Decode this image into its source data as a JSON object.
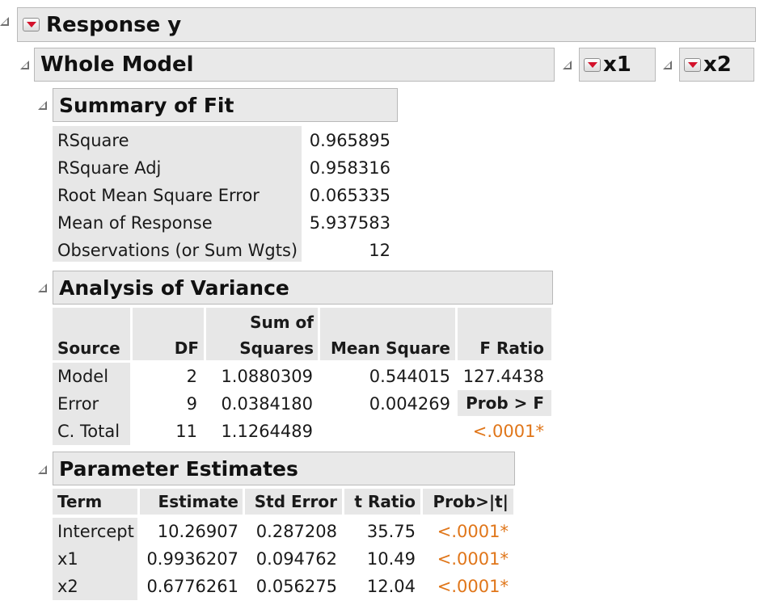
{
  "response": {
    "title": "Response y"
  },
  "whole_model": {
    "title": "Whole Model"
  },
  "side_reports": [
    {
      "label": "x1"
    },
    {
      "label": "x2"
    }
  ],
  "summary_of_fit": {
    "title": "Summary of Fit",
    "rows": [
      {
        "label": "RSquare",
        "value": "0.965895"
      },
      {
        "label": "RSquare Adj",
        "value": "0.958316"
      },
      {
        "label": "Root Mean Square Error",
        "value": "0.065335"
      },
      {
        "label": "Mean of Response",
        "value": "5.937583"
      },
      {
        "label": "Observations (or Sum Wgts)",
        "value": "12"
      }
    ]
  },
  "anova": {
    "title": "Analysis of Variance",
    "headers": {
      "source": "Source",
      "df": "DF",
      "ss_line1": "Sum of",
      "ss_line2": "Squares",
      "ms": "Mean Square",
      "f": "F Ratio",
      "prob": "Prob > F"
    },
    "rows": [
      {
        "source": "Model",
        "df": "2",
        "ss": "1.0880309",
        "ms": "0.544015",
        "f": "127.4438"
      },
      {
        "source": "Error",
        "df": "9",
        "ss": "0.0384180",
        "ms": "0.004269"
      },
      {
        "source": "C. Total",
        "df": "11",
        "ss": "1.1264489"
      }
    ],
    "prob_value": "<.0001*"
  },
  "parameter_estimates": {
    "title": "Parameter Estimates",
    "headers": [
      "Term",
      "Estimate",
      "Std Error",
      "t Ratio",
      "Prob>|t|"
    ],
    "rows": [
      {
        "term": "Intercept",
        "estimate": "10.26907",
        "std_error": "0.287208",
        "t_ratio": "35.75",
        "prob": "<.0001*"
      },
      {
        "term": "x1",
        "estimate": "0.9936207",
        "std_error": "0.094762",
        "t_ratio": "10.49",
        "prob": "<.0001*"
      },
      {
        "term": "x2",
        "estimate": "0.6776261",
        "std_error": "0.056275",
        "t_ratio": "12.04",
        "prob": "<.0001*"
      }
    ]
  },
  "colors": {
    "significant": "#e0761a",
    "menu_arrow": "#d3122b",
    "header_bg": "#e9e9e9"
  },
  "icons": [
    "disclosure-triangle-icon",
    "red-triangle-menu-icon"
  ]
}
